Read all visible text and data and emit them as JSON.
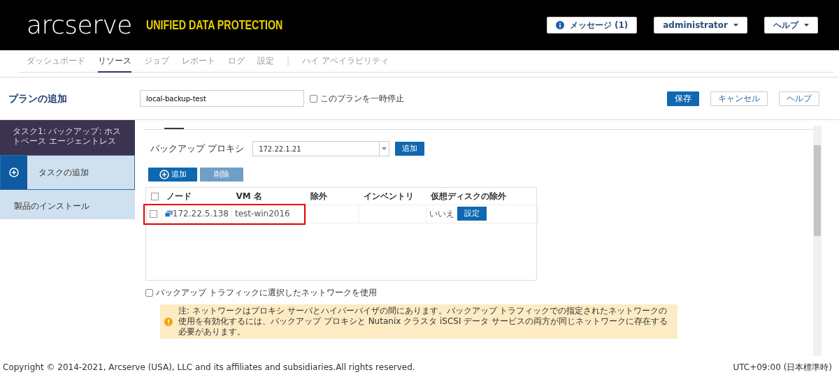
{
  "header": {
    "logo": "arcserve",
    "product": "UNIFIED DATA PROTECTION",
    "buttons": [
      {
        "kind": "info",
        "label": "メッセージ (1)"
      },
      {
        "kind": "dropdown",
        "label": "administrator"
      },
      {
        "kind": "dropdown",
        "label": "ヘルプ"
      }
    ]
  },
  "nav": [
    {
      "label": "ダッシュボード",
      "selected": false
    },
    {
      "label": "リソース",
      "selected": true
    },
    {
      "label": "ジョブ",
      "selected": false
    },
    {
      "label": "レポート",
      "selected": false
    },
    {
      "label": "ログ",
      "selected": false
    },
    {
      "label": "設定",
      "selected": false
    },
    {
      "kind": "separator",
      "label": "|"
    },
    {
      "label": "ハイ アベイラビリティ",
      "selected": false
    }
  ],
  "plan": {
    "title": "プランの追加",
    "name": "local-backup-test",
    "pause": {
      "label": "このプランを一時停止",
      "checked": false
    },
    "buttons": [
      {
        "kind": "primary",
        "label": "保存"
      },
      {
        "kind": "outline",
        "label": "キャンセル"
      },
      {
        "kind": "outline",
        "label": "ヘルプ"
      }
    ]
  },
  "sidebar": [
    {
      "kind": "task",
      "label": "タスク1: バックアップ: ホストベース エージェントレス"
    },
    {
      "kind": "add",
      "label": "タスクの追加"
    },
    {
      "kind": "item",
      "label": "製品のインストール"
    }
  ],
  "proxy": {
    "label": "バックアップ プロキシ",
    "value": "172.22.1.21",
    "button": "追加"
  },
  "toolbar": [
    {
      "label": "追加",
      "disabled": false
    },
    {
      "label": "削除",
      "disabled": true
    }
  ],
  "table": {
    "all_checked": false,
    "columns": [
      "ノード",
      "VM 名",
      "除外",
      "インベントリ",
      "仮想ディスクの除外"
    ],
    "rows": [
      {
        "checked": false,
        "highlighted": true,
        "node": "172.22.5.138",
        "vm": "test-win2016",
        "exclude": "",
        "inventory": "",
        "disk_exclude": "いいえ",
        "action": "設定"
      }
    ]
  },
  "network": {
    "label": "バックアップ トラフィックに選択したネットワークを使用",
    "checked": false
  },
  "note": "注: ネットワークはプロキシ サーバとハイパーバイザの間にあります。バックアップ トラフィックでの指定されたネットワークの使用を有効化するには、バックアップ プロキシと Nutanix クラスタ iSCSI データ サービスの両方が同じネットワークに存在する必要があります。",
  "footer": {
    "copyright": "Copyright © 2014-2021, Arcserve (USA), LLC and its affiliates and subsidiaries.All rights reserved.",
    "timezone": "UTC+09:00 (日本標準時)"
  }
}
